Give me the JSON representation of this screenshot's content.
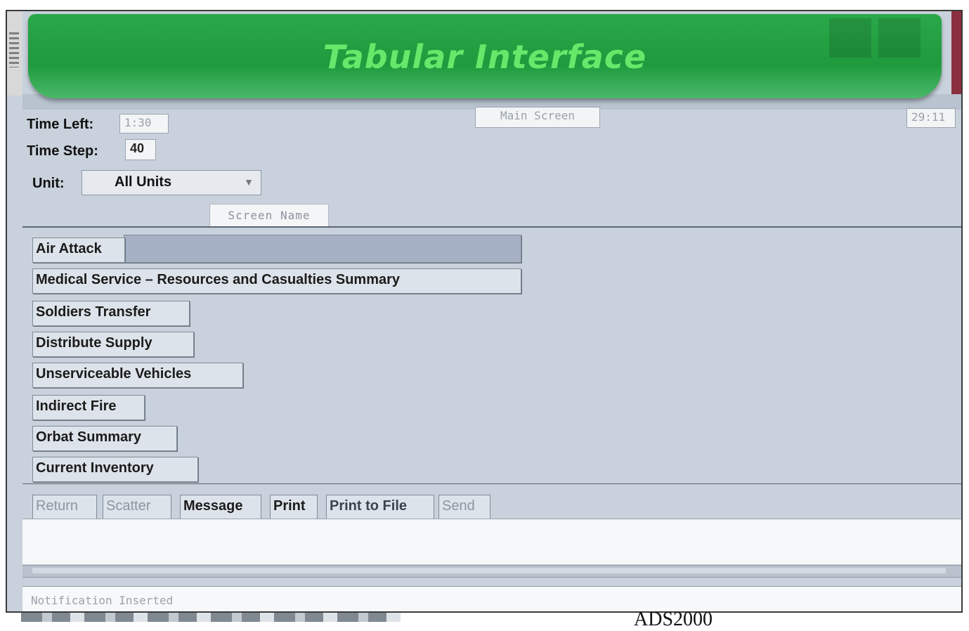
{
  "window": {
    "banner_title": "Tabular Interface",
    "screen_name_center": "Main Screen",
    "corner_value": "29:11"
  },
  "controls": {
    "time_left_label": "Time Left:",
    "time_left_value": "1:30",
    "time_step_label": "Time Step:",
    "time_step_value": "40",
    "unit_label": "Unit:",
    "unit_selected": "All Units",
    "screen_name_button": "Screen Name"
  },
  "tabs": [
    {
      "label": "Air Attack"
    },
    {
      "label": "Medical Service – Resources and Casualties Summary"
    },
    {
      "label": "Soldiers Transfer"
    },
    {
      "label": "Distribute Supply"
    },
    {
      "label": "Unserviceable Vehicles"
    },
    {
      "label": "Indirect Fire"
    },
    {
      "label": "Orbat Summary"
    },
    {
      "label": "Current Inventory"
    }
  ],
  "toolbar": {
    "return": "Return",
    "scatter": "Scatter",
    "message": "Message",
    "print": "Print",
    "print_to_file": "Print to File",
    "send": "Send"
  },
  "status": {
    "text": "Notification Inserted"
  },
  "caption": "ADS2000",
  "colors": {
    "banner_green": "#2aa84a",
    "banner_title": "#66e86a",
    "panel_bg": "#c9d2dc",
    "active_tab_bg": "#a6b0c4"
  }
}
